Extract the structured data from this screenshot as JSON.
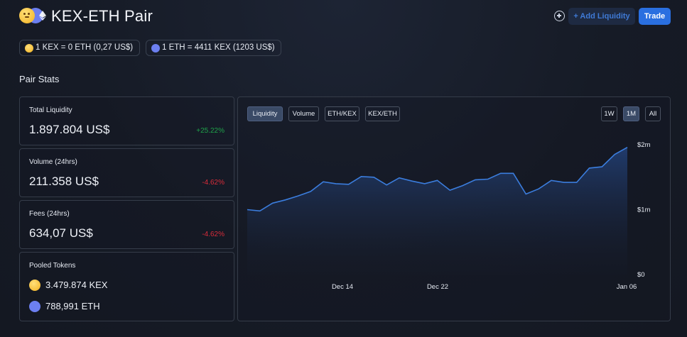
{
  "header": {
    "title": "KEX-ETH Pair",
    "add_liquidity": "+ Add Liquidity",
    "trade": "Trade"
  },
  "rates": [
    {
      "text": "1 KEX = 0 ETH (0,27 US$)",
      "icon": "kex-token-icon"
    },
    {
      "text": "1 ETH = 4411 KEX (1203 US$)",
      "icon": "eth-token-icon"
    }
  ],
  "stats": {
    "title": "Pair Stats",
    "liquidity": {
      "label": "Total Liquidity",
      "value": "1.897.804 US$",
      "change": "+25.22%"
    },
    "volume": {
      "label": "Volume (24hrs)",
      "value": "211.358 US$",
      "change": "-4.62%"
    },
    "fees": {
      "label": "Fees (24hrs)",
      "value": "634,07 US$",
      "change": "-4.62%"
    },
    "pooled": {
      "label": "Pooled Tokens",
      "kex": "3.479.874 KEX",
      "eth": "788,991 ETH"
    }
  },
  "chart": {
    "tabs": [
      "Liquidity",
      "Volume",
      "ETH/KEX",
      "KEX/ETH"
    ],
    "active_tab": "Liquidity",
    "ranges": [
      "1W",
      "1M",
      "All"
    ],
    "active_range": "1M",
    "colors": {
      "line": "#3b7ddd",
      "positive": "#1fa34a",
      "negative": "#d92c3a"
    }
  },
  "chart_data": {
    "type": "area",
    "x_tick_labels": [
      "Dec 14",
      "Dec 22",
      "Jan 06"
    ],
    "y_tick_labels": [
      "$2m",
      "$1m",
      "$0"
    ],
    "ylim": [
      0,
      2000000
    ],
    "values": [
      1000000,
      980000,
      1100000,
      1150000,
      1210000,
      1280000,
      1430000,
      1400000,
      1390000,
      1510000,
      1500000,
      1380000,
      1490000,
      1440000,
      1400000,
      1450000,
      1300000,
      1370000,
      1460000,
      1470000,
      1560000,
      1560000,
      1240000,
      1320000,
      1450000,
      1420000,
      1420000,
      1640000,
      1660000,
      1850000,
      1960000
    ]
  }
}
